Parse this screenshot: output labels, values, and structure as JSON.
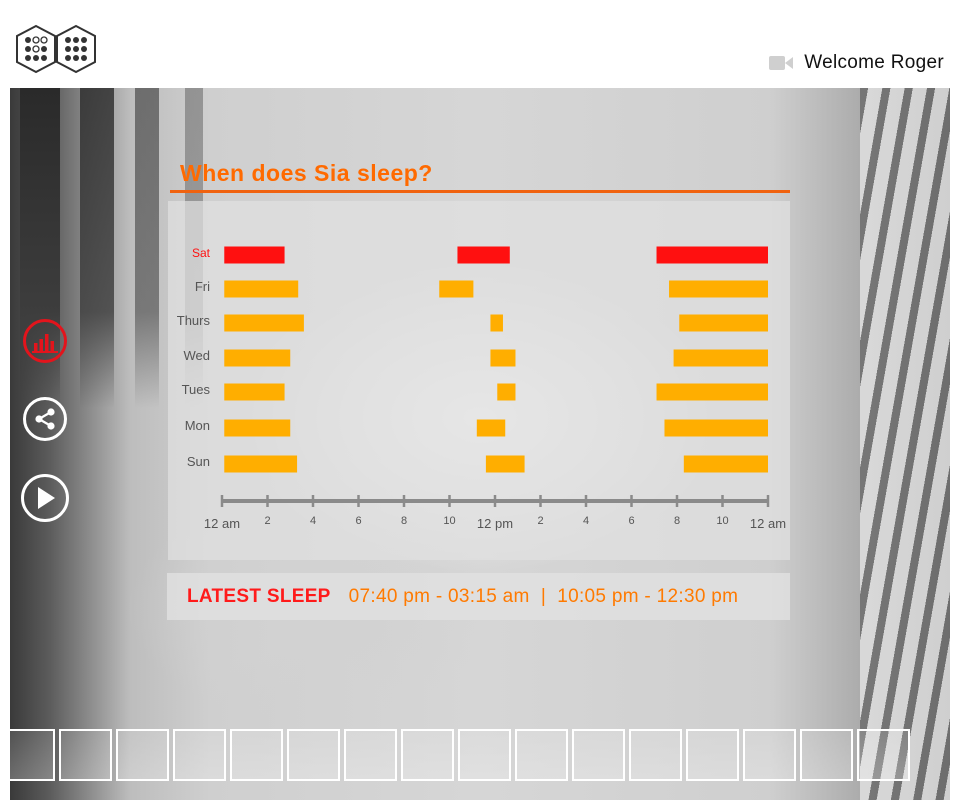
{
  "header": {
    "welcome": "Welcome Roger",
    "logo_icon": "hexagon-dots-logo",
    "camera_icon": "video-camera-icon"
  },
  "sidebar": {
    "buttons": [
      {
        "name": "sleep-chart-button",
        "icon": "bar-chart-icon",
        "active": true
      },
      {
        "name": "share-button",
        "icon": "share-icon",
        "active": false
      },
      {
        "name": "play-button",
        "icon": "play-icon",
        "active": false
      }
    ]
  },
  "chart": {
    "title": "When does Sia sleep?"
  },
  "chart_data": {
    "type": "bar",
    "subtype": "horizontal-timeline",
    "title": "When does Sia sleep?",
    "categories": [
      "Sat",
      "Fri",
      "Thurs",
      "Wed",
      "Tues",
      "Mon",
      "Sun"
    ],
    "highlight_category": "Sat",
    "x_domain_hours": [
      0,
      24
    ],
    "x_tick_labels": [
      {
        "hour": 0,
        "label": "12 am"
      },
      {
        "hour": 2,
        "label": "2"
      },
      {
        "hour": 4,
        "label": "4"
      },
      {
        "hour": 6,
        "label": "6"
      },
      {
        "hour": 8,
        "label": "8"
      },
      {
        "hour": 10,
        "label": "10"
      },
      {
        "hour": 12,
        "label": "12 pm"
      },
      {
        "hour": 14,
        "label": "2"
      },
      {
        "hour": 16,
        "label": "4"
      },
      {
        "hour": 18,
        "label": "6"
      },
      {
        "hour": 20,
        "label": "8"
      },
      {
        "hour": 22,
        "label": "10"
      },
      {
        "hour": 24,
        "label": "12 am"
      }
    ],
    "sleep_intervals_hours": {
      "Sat": [
        [
          0.1,
          2.75
        ],
        [
          10.35,
          12.65
        ],
        [
          19.1,
          24
        ]
      ],
      "Fri": [
        [
          0.1,
          3.35
        ],
        [
          9.55,
          11.05
        ],
        [
          19.65,
          24
        ]
      ],
      "Thurs": [
        [
          0.1,
          3.6
        ],
        [
          11.8,
          12.35
        ],
        [
          20.1,
          24
        ]
      ],
      "Wed": [
        [
          0.1,
          3.0
        ],
        [
          11.8,
          12.9
        ],
        [
          19.85,
          24
        ]
      ],
      "Tues": [
        [
          0.1,
          2.75
        ],
        [
          12.1,
          12.9
        ],
        [
          19.1,
          24
        ]
      ],
      "Mon": [
        [
          0.1,
          3.0
        ],
        [
          11.2,
          12.45
        ],
        [
          19.45,
          24
        ]
      ],
      "Sun": [
        [
          0.1,
          3.3
        ],
        [
          11.6,
          13.3
        ],
        [
          20.3,
          24
        ]
      ]
    },
    "colors": {
      "default": "#ffae00",
      "highlight": "#ff1010",
      "axis": "#8a8a8a",
      "day_label": "#555555",
      "highlight_label": "#ff1010"
    }
  },
  "latest": {
    "label": "LATEST SLEEP",
    "times": "07:40 pm - 03:15 am  |  10:05 pm - 12:30 pm"
  },
  "filmstrip": {
    "count": 16
  }
}
